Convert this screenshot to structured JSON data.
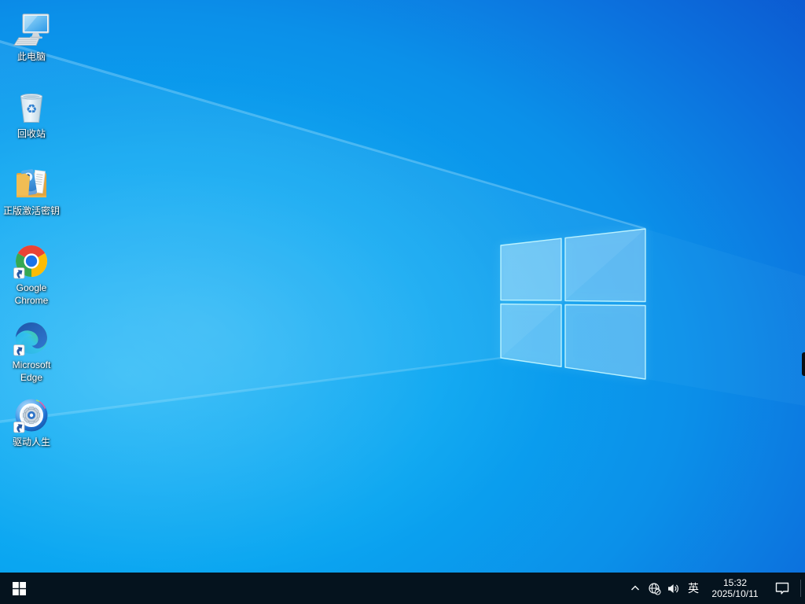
{
  "desktop": {
    "icons": [
      {
        "label": "此电脑",
        "icon": "this-pc-icon",
        "shortcut": false
      },
      {
        "label": "回收站",
        "icon": "recycle-bin-icon",
        "shortcut": false
      },
      {
        "label": "正版激活密钥",
        "icon": "folder-key-icon",
        "shortcut": false
      },
      {
        "label": "Google Chrome",
        "icon": "chrome-icon",
        "shortcut": true
      },
      {
        "label": "Microsoft Edge",
        "icon": "edge-icon",
        "shortcut": true
      },
      {
        "label": "驱动人生",
        "icon": "driver-life-icon",
        "shortcut": true
      }
    ]
  },
  "wallpaper": {
    "style": "windows-10-light-rays-logo",
    "bright_color": "#0aa6f1",
    "deep_color": "#0a41c4",
    "logo_edge_color": "#c8f8ff"
  },
  "taskbar": {
    "background": "#05131e",
    "start_icon": "windows-logo-icon",
    "tray": {
      "overflow_icon": "chevron-up-icon",
      "network_icon": "globe-no-internet-icon",
      "volume_icon": "speaker-icon",
      "language": "英",
      "clock": {
        "time": "15:32",
        "date": "2025/10/11"
      },
      "action_center_icon": "notification-bubble-icon"
    }
  }
}
